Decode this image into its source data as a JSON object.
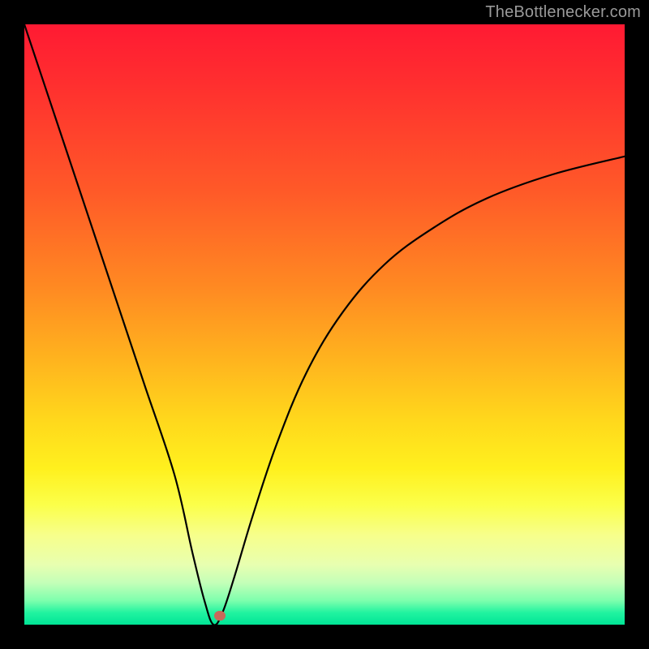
{
  "attribution": "TheBottlenecker.com",
  "chart_data": {
    "type": "line",
    "title": "",
    "xlabel": "",
    "ylabel": "",
    "xlim": [
      0,
      100
    ],
    "ylim": [
      0,
      100
    ],
    "series": [
      {
        "name": "bottleneck-curve",
        "x": [
          0,
          5,
          10,
          15,
          20,
          25,
          28,
          30,
          31.5,
          33,
          35,
          38,
          42,
          47,
          53,
          60,
          68,
          77,
          88,
          100
        ],
        "y": [
          100,
          85,
          70,
          55,
          40,
          25,
          12,
          4,
          0,
          2,
          8,
          18,
          30,
          42,
          52,
          60,
          66,
          71,
          75,
          78
        ]
      }
    ],
    "marker": {
      "x": 32.5,
      "y": 1.5,
      "color": "#c86a5a"
    },
    "background_gradient": {
      "top": "#ff1a33",
      "mid1": "#ff8a22",
      "mid2": "#ffd81c",
      "mid3": "#f7ff8a",
      "bottom": "#00e596"
    }
  }
}
